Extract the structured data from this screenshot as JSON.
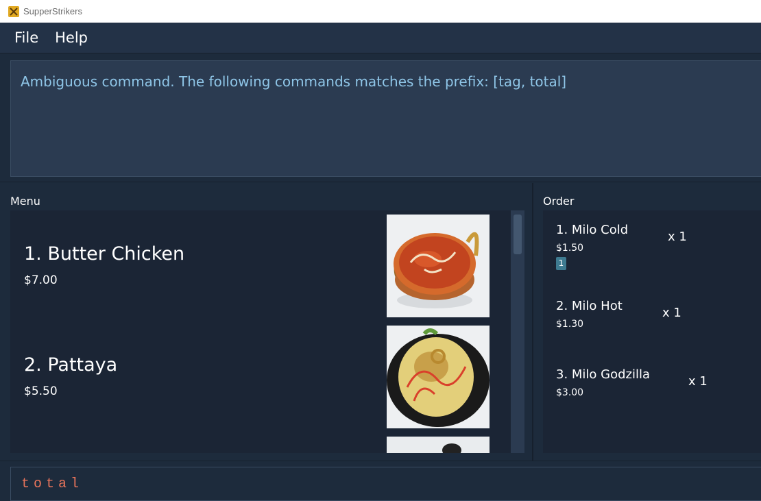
{
  "window": {
    "title": "SupperStrikers"
  },
  "menubar": {
    "items": [
      {
        "label": "File"
      },
      {
        "label": "Help"
      }
    ]
  },
  "result": {
    "text": "Ambiguous command. The following commands matches the prefix: [tag, total]"
  },
  "menu": {
    "label": "Menu",
    "items": [
      {
        "name": "1.  Butter Chicken",
        "price": "$7.00",
        "image_icon": "butter-chicken-image"
      },
      {
        "name": "2.  Pattaya",
        "price": "$5.50",
        "image_icon": "pattaya-image"
      }
    ]
  },
  "order": {
    "label": "Order",
    "items": [
      {
        "name": "1.  Milo Cold",
        "price": "$1.50",
        "qty": "x 1",
        "tag": "1"
      },
      {
        "name": "2.  Milo Hot",
        "price": "$1.30",
        "qty": "x 1"
      },
      {
        "name": "3.  Milo Godzilla",
        "price": "$3.00",
        "qty": "x 1"
      }
    ]
  },
  "command": {
    "value": "total"
  },
  "colors": {
    "accent_result": "#8fc6e8",
    "command_text": "#e8745b",
    "tag_bg": "#3e7b91",
    "background": "#1d2b3c"
  }
}
